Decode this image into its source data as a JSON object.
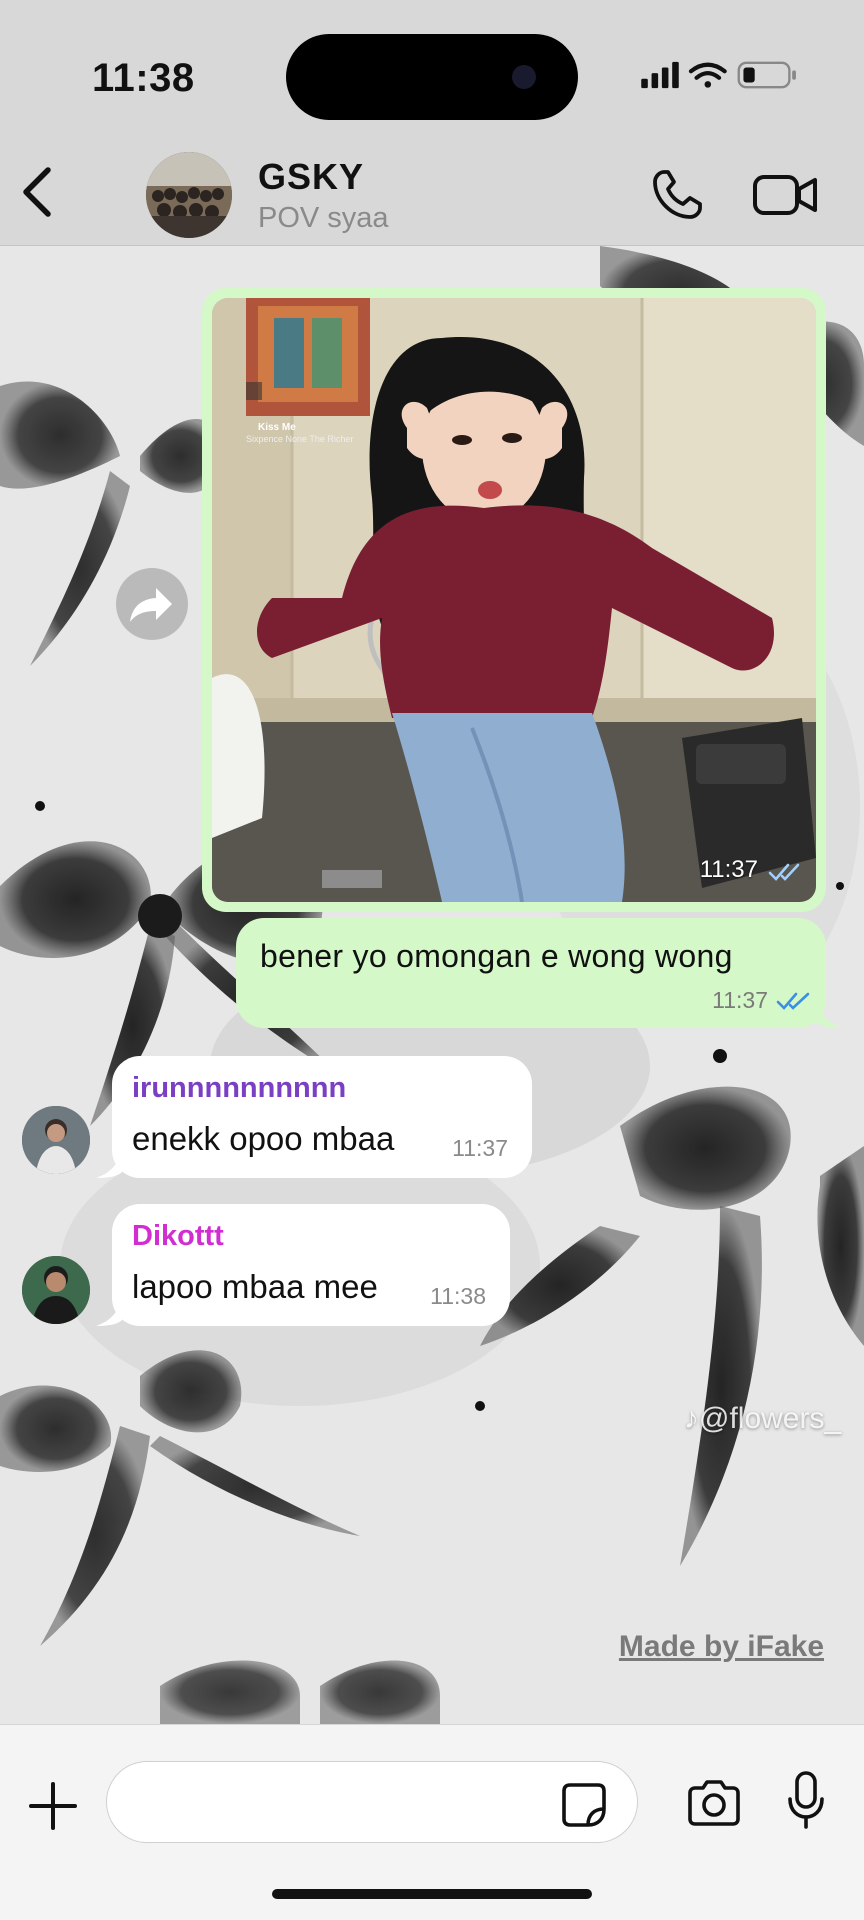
{
  "status_bar": {
    "time": "11:38"
  },
  "header": {
    "title": "GSKY",
    "subtitle": "POV syaa"
  },
  "messages": [
    {
      "type": "image",
      "direction": "outgoing",
      "time": "11:37",
      "album_overlay": {
        "title": "Kiss Me",
        "artist": "Sixpence None The Richer"
      }
    },
    {
      "type": "text",
      "direction": "outgoing",
      "text": "bener yo omongan e wong wong",
      "time": "11:37"
    },
    {
      "type": "text",
      "direction": "incoming",
      "sender": "irunnnnnnnnnn",
      "sender_color": "#7a3fc2",
      "text": "enekk opoo mbaa",
      "time": "11:37"
    },
    {
      "type": "text",
      "direction": "incoming",
      "sender": "Dikottt",
      "sender_color": "#d12ed1",
      "text": "lapoo mbaa mee",
      "time": "11:38"
    }
  ],
  "watermarks": {
    "tiktok": "@flowers_",
    "made_by": "Made by iFake"
  },
  "composer": {
    "placeholder": ""
  },
  "colors": {
    "outgoing_bubble": "#d4f8c8",
    "read_ticks": "#3a8ee6"
  }
}
